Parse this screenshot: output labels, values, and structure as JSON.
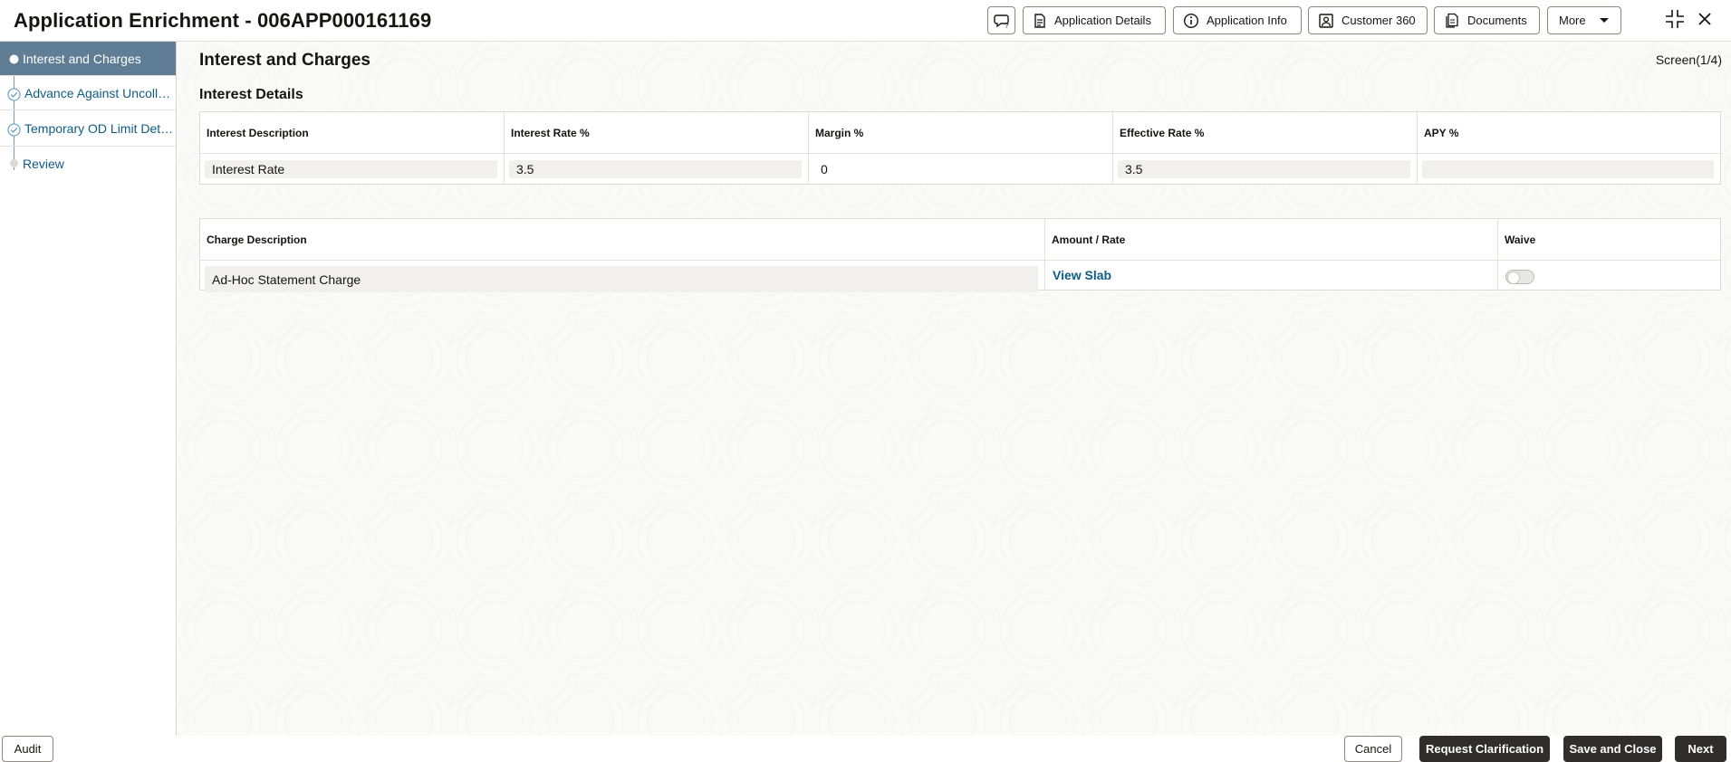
{
  "header": {
    "title": "Application Enrichment - 006APP000161169",
    "buttons": {
      "application_details": "Application Details",
      "application_info": "Application Info",
      "customer_360": "Customer 360",
      "documents": "Documents",
      "more": "More"
    },
    "icons": {
      "chat": "chat-question-icon",
      "application_details": "document-icon",
      "application_info": "info-icon",
      "customer_360": "person-card-icon",
      "documents": "documents-icon",
      "more": "caret-down-icon",
      "minimize": "collapse-icon",
      "close": "close-icon"
    }
  },
  "sidebar": {
    "items": [
      {
        "label": "Interest and Charges",
        "state": "active"
      },
      {
        "label": "Advance Against Uncollected Funds",
        "state": "completed"
      },
      {
        "label": "Temporary OD Limit Details",
        "state": "completed"
      },
      {
        "label": "Review",
        "state": "pending"
      }
    ]
  },
  "main": {
    "section_title": "Interest and Charges",
    "screen_indicator": "Screen(1/4)",
    "interest_details": {
      "title": "Interest Details",
      "columns": [
        "Interest Description",
        "Interest Rate %",
        "Margin %",
        "Effective Rate %",
        "APY %"
      ],
      "rows": [
        [
          "Interest Rate",
          "3.5",
          "0",
          "3.5",
          ""
        ]
      ]
    },
    "charges": {
      "columns": [
        "Charge Description",
        "Amount / Rate",
        "Waive"
      ],
      "rows": [
        {
          "description": "Ad-Hoc Statement Charge",
          "amount_link": "View Slab",
          "waive": false
        }
      ]
    }
  },
  "footer": {
    "audit": "Audit",
    "cancel": "Cancel",
    "request_clarification": "Request Clarification",
    "save_and_close": "Save and Close",
    "next": "Next"
  },
  "colors": {
    "active_sidebar": "#5f7d95",
    "link": "#0f5c84",
    "dark_button": "#312d2a"
  }
}
